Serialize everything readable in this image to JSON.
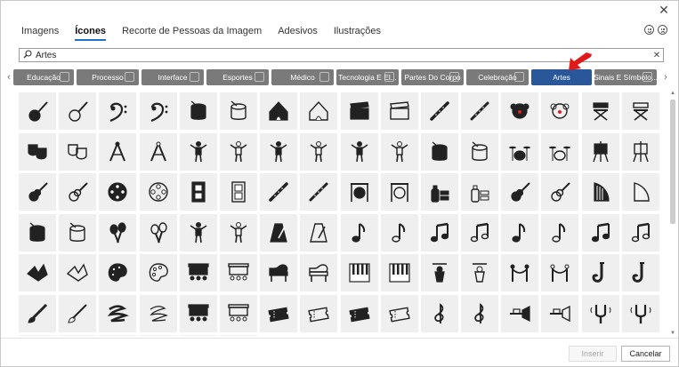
{
  "window": {
    "close_glyph": "✕"
  },
  "tabs": [
    {
      "label": "Imagens",
      "active": false
    },
    {
      "label": "Ícones",
      "active": true
    },
    {
      "label": "Recorte de Pessoas da Imagem",
      "active": false
    },
    {
      "label": "Adesivos",
      "active": false
    },
    {
      "label": "Ilustrações",
      "active": false
    }
  ],
  "search": {
    "value": "Artes",
    "placeholder": ""
  },
  "categories": [
    {
      "label": "Educação",
      "selected": false,
      "width": 68
    },
    {
      "label": "Processo",
      "selected": false,
      "width": 70
    },
    {
      "label": "Interface",
      "selected": false,
      "width": 70
    },
    {
      "label": "Esportes",
      "selected": false,
      "width": 70
    },
    {
      "label": "Médico",
      "selected": false,
      "width": 70
    },
    {
      "label": "Tecnologia E El...",
      "selected": false,
      "width": 70
    },
    {
      "label": "Partes Do Corpo",
      "selected": false,
      "width": 70
    },
    {
      "label": "Celebração",
      "selected": false,
      "width": 70
    },
    {
      "label": "Artes",
      "selected": true,
      "width": 68
    },
    {
      "label": "Sinais E Símbolo...",
      "selected": false,
      "width": 70
    }
  ],
  "icons": [
    "banjo-icon",
    "banjo-outline-icon",
    "bass-clef-icon",
    "bass-clef-outline-icon",
    "drum-icon",
    "drum-outline-icon",
    "circus-tent-icon",
    "circus-tent-outline-icon",
    "clapperboard-icon",
    "clapperboard-outline-icon",
    "clarinet-icon",
    "clarinet-outline-icon",
    "clown-icon",
    "clown-outline-icon",
    "director-chair-icon",
    "director-chair-outline-icon",
    "theater-masks-icon",
    "theater-masks-outline-icon",
    "compass-icon",
    "compass-outline-icon",
    "mannequin-icon",
    "mannequin-outline-icon",
    "conductor-icon",
    "conductor-outline-icon",
    "figure-icon",
    "figure-outline-icon",
    "snare-drum-icon",
    "snare-drum-outline-icon",
    "drum-kit-icon",
    "drum-kit-outline-icon",
    "easel-icon",
    "easel-outline-icon",
    "electric-guitar-icon",
    "electric-guitar-outline-icon",
    "film-reel-icon",
    "film-reel-outline-icon",
    "film-strip-icon",
    "film-strip-outline-icon",
    "flute-icon",
    "flute-outline-icon",
    "gong-icon",
    "gong-outline-icon",
    "graffiti-icon",
    "graffiti-outline-icon",
    "guitar-icon",
    "guitar-outline-icon",
    "harp-icon",
    "harp-outline-icon",
    "marching-drum-icon",
    "marching-drum-outline-icon",
    "maracas-icon",
    "maracas-outline-icon",
    "dancer-icon",
    "dancer-outline-icon",
    "metronome-icon",
    "metronome-outline-icon",
    "music-note-icon",
    "music-note-outline-icon",
    "music-notes-icon",
    "music-notes-outline-icon",
    "eighth-note-icon",
    "eighth-note-outline-icon",
    "sixteenth-notes-icon",
    "sixteenth-notes-outline-icon",
    "origami-icon",
    "origami-outline-icon",
    "palette-icon",
    "palette-outline-icon",
    "stage-icon",
    "stage-outline-icon",
    "piano-icon",
    "piano-outline-icon",
    "piano-keys-icon",
    "piano-keys-outline-icon",
    "puppet-icon",
    "puppet-outline-icon",
    "rope-barrier-icon",
    "rope-barrier-outline-icon",
    "saxophone-icon",
    "saxophone-outline-icon",
    "paintbrush-icon",
    "paintbrush-outline-icon",
    "scribble-icon",
    "scribble-outline-icon",
    "theater-seats-icon",
    "theater-seats-outline-icon",
    "ticket-icon",
    "ticket-outline-icon",
    "tickets-icon",
    "tickets-outline-icon",
    "treble-clef-icon",
    "treble-clef-outline-icon",
    "trumpet-icon",
    "trumpet-outline-icon",
    "tuning-fork-icon",
    "tuning-fork-outline-icon"
  ],
  "footer": {
    "insert_label": "Inserir",
    "cancel_label": "Cancelar"
  }
}
